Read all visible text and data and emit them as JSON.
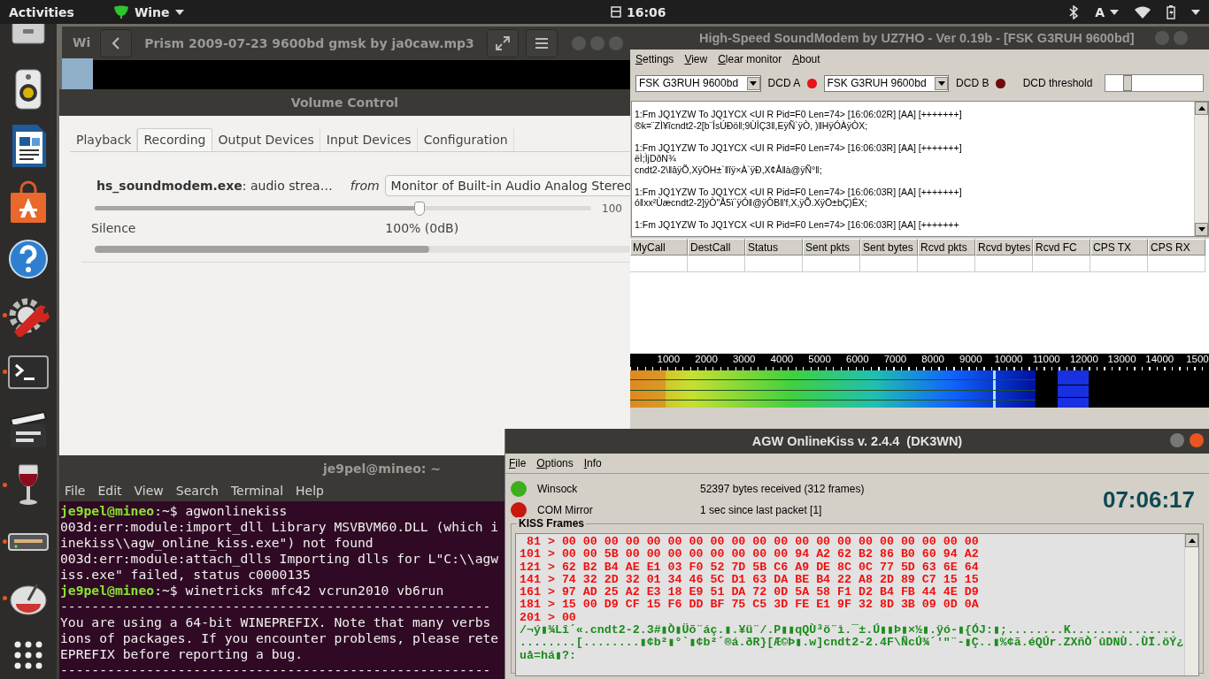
{
  "top_bar": {
    "activities": "Activities",
    "app_menu": "Wine",
    "clock": "16:06",
    "keyboard": "A"
  },
  "dock": {
    "items": [
      {
        "kind": "drive",
        "running": false
      },
      {
        "kind": "speaker",
        "running": false
      },
      {
        "kind": "writer",
        "running": false
      },
      {
        "kind": "store",
        "running": false
      },
      {
        "kind": "help",
        "running": false
      },
      {
        "kind": "tools",
        "running": true
      },
      {
        "kind": "terminal",
        "running": true
      },
      {
        "kind": "clapper",
        "running": false
      },
      {
        "kind": "wine",
        "running": true
      },
      {
        "kind": "modem",
        "running": true
      },
      {
        "kind": "knob",
        "running": true
      },
      {
        "kind": "grid",
        "running": false
      }
    ]
  },
  "background_window": {
    "title": "Wi"
  },
  "player": {
    "title": "Prism 2009-07-23 9600bd gmsk by ja0caw.mp3"
  },
  "volume_control": {
    "title": "Volume Control",
    "tabs": [
      {
        "label": "Playback",
        "selected": false
      },
      {
        "label": "Recording",
        "selected": true
      },
      {
        "label": "Output Devices",
        "selected": false
      },
      {
        "label": "Input Devices",
        "selected": false
      },
      {
        "label": "Configuration",
        "selected": false
      }
    ],
    "stream": {
      "app": "hs_soundmodem.exe",
      "description": ": audio strea…",
      "from_label": "from",
      "source": "Monitor of Built-in Audio Analog Stereo",
      "level": 0.654,
      "scale_max": "100",
      "min_label": "Silence",
      "mark_label": "100% (0dB)",
      "peak": {
        "level": 0.61
      }
    }
  },
  "soundmodem": {
    "title": "High-Speed SoundModem by UZ7HO - Ver 0.19b - [FSK G3RUH 9600bd]",
    "menu": [
      "Settings",
      "View",
      "Clear monitor",
      "About"
    ],
    "channels": [
      {
        "modem": "FSK G3RUH 9600bd",
        "dcd_label": "DCD A",
        "on": true
      },
      {
        "modem": "FSK G3RUH 9600bd",
        "dcd_label": "DCD B",
        "on": false
      }
    ],
    "threshold": {
      "label": "DCD threshold",
      "level": 0.18
    },
    "monitor_lines": [
      "1:Fm JQ1YZW To JQ1YCX <UI R Pid=F0 Len=74> [16:06:02R] [AA] [+++++++]",
      "®k=¨ZÌ¥îcndt2-2[b¨ÎsÚÐö‖;9ÙÎÇ3‖,EÿÑ`ÿÒ, )‖HÿÓÀÿÒX;",
      "1:Fm JQ1YZW To JQ1YCX <UI R Pid=F0 Len=74> [16:06:03R] [AA] [+++++++]",
      "ëÌ;ÌjDðN¾",
      "cndt2-2\\‖âÿÕ,XÿÖH±`‖îÿ×À`ÿÐ,X¢Å‖à@ÿÑ°‖;",
      "1:Fm JQ1YZW To JQ1YCX <UI R Pid=F0 Len=74> [16:06:03R] [AA] [+++++++]",
      "ó‖xx²Ùæcndt2-2]ÿÒ\"Å5ï`ÿÓ‖@ÿÔB‖'f,X,ÿÕ.XÿÖ±bÇ)ÊX;",
      "1:Fm JQ1YZW To JQ1YCX <UI R Pid=F0 Len=74> [16:06:03R] [AA] [+++++++"
    ],
    "table": {
      "columns": [
        "MyCall",
        "DestCall",
        "Status",
        "Sent pkts",
        "Sent bytes",
        "Rcvd pkts",
        "Rcvd bytes",
        "Rcvd FC",
        "CPS TX",
        "CPS RX"
      ]
    },
    "spectrum": {
      "ticks": [
        "1000",
        "2000",
        "3000",
        "4000",
        "5000",
        "6000",
        "7000",
        "8000",
        "9000",
        "10000",
        "11000",
        "12000",
        "13000",
        "14000",
        "1500"
      ]
    }
  },
  "terminal": {
    "title": "je9pel@mineo: ~",
    "menu": [
      "File",
      "Edit",
      "View",
      "Search",
      "Terminal",
      "Help"
    ],
    "lines": [
      {
        "kind": "prompt",
        "user": "je9pel@mineo",
        "text": ":~$ agwonlinekiss"
      },
      {
        "kind": "output",
        "text": "003d:err:module:import_dll Library MSVBVM60.DLL (which i"
      },
      {
        "kind": "output",
        "text": "inekiss\\\\agw_online_kiss.exe\") not found"
      },
      {
        "kind": "output",
        "text": "003d:err:module:attach_dlls Importing dlls for L\"C:\\\\agw"
      },
      {
        "kind": "output",
        "text": "iss.exe\" failed, status c0000135"
      },
      {
        "kind": "prompt",
        "user": "je9pel@mineo",
        "text": ":~$ winetricks mfc42 vcrun2010 vb6run"
      },
      {
        "kind": "output",
        "text": "-------------------------------------------------------"
      },
      {
        "kind": "output",
        "text": "You are using a 64-bit WINEPREFIX. Note that many verbs"
      },
      {
        "kind": "output",
        "text": "ions of packages. If you encounter problems, please rete"
      },
      {
        "kind": "output",
        "text": "EPREFIX before reporting a bug."
      },
      {
        "kind": "output",
        "text": "-------------------------------------------------------"
      }
    ]
  },
  "agw": {
    "title": "AGW OnlineKiss v. 2.4.4  (DK3WN)",
    "menu": [
      "File",
      "Options",
      "Info"
    ],
    "indicators": [
      {
        "label": "Winsock",
        "color": "#3cb01c",
        "status": "52397 bytes received (312 frames)"
      },
      {
        "label": "COM Mirror",
        "color": "#c8180e",
        "status": "1 sec since last packet [1]"
      }
    ],
    "clock": "07:06:17",
    "frames_title": "KISS Frames",
    "hex_lines": [
      " 81 > 00 00 00 00 00 00 00 00 00 00 00 00 00 00 00 00 00 00 00 00",
      "101 > 00 00 5B 00 00 00 00 00 00 00 00 94 A2 62 B2 86 B0 60 94 A2",
      "121 > 62 B2 B4 AE E1 03 F0 52 7D 5B C6 A9 DE 8C 0C 77 5D 63 6E 64",
      "141 > 74 32 2D 32 01 34 46 5C D1 63 DA BE B4 22 A8 2D 89 C7 15 15",
      "161 > 97 AD 25 A2 E3 18 E9 51 DA 72 0D 5A 58 F1 D2 B4 FB 44 4E D9",
      "181 > 15 00 D9 CF 15 F6 DD BF 75 C5 3D FE E1 9F 32 8D 3B 09 0D 0A",
      "201 > 00"
    ],
    "ascii_lines": [
      "/¬ý▮¾Lî´«.cndt2-2.3#▮Ò▮Üõ¨áç.▮.¥ü¨/.P▮▮qQÙ³ö¨ì.¯±.Ú▮▮Þ▮×½▮.ÿó-▮{ÓJ:▮;........K...............",
      "........[........▮¢b²▮°`▮¢b²´®á.ðR}[Æ©Þ▮.w]cndt2-2.4F\\ÑcÚ¾´'\"¨-▮Ç..▮%¢ã.éQÚr.ZXñÒ´ûDNÙ..ÙÏ.öÝ¿",
      "uå=há▮?:"
    ]
  }
}
